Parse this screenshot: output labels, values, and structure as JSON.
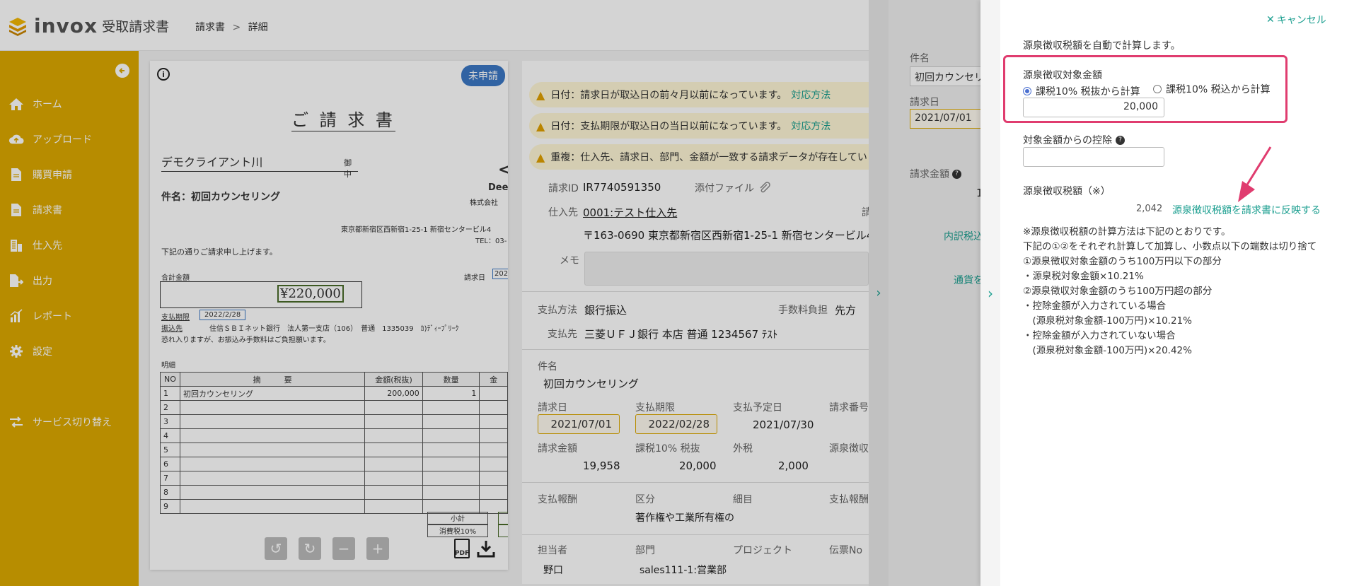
{
  "header": {
    "logo_text": "invox",
    "logo_sub": "受取請求書",
    "breadcrumb_1": "請求書",
    "breadcrumb_sep": ">",
    "breadcrumb_2": "詳細"
  },
  "sidebar": {
    "items": [
      {
        "label": "ホーム",
        "icon": "home-icon"
      },
      {
        "label": "アップロード",
        "icon": "cloud-upload-icon"
      },
      {
        "label": "購買申請",
        "icon": "file-icon"
      },
      {
        "label": "請求書",
        "icon": "file-icon"
      },
      {
        "label": "仕入先",
        "icon": "building-icon"
      },
      {
        "label": "出力",
        "icon": "export-icon"
      },
      {
        "label": "レポート",
        "icon": "chart-icon"
      },
      {
        "label": "設定",
        "icon": "gear-icon"
      }
    ],
    "service_switch": "サービス切り替え"
  },
  "document": {
    "status_badge": "未申請",
    "title": "ご 請 求 書",
    "client": "デモクライアント川",
    "client_suffix": "御中",
    "subject": "件名：初回カウンセリング",
    "company_short": "Deep",
    "company_suffix": "株式会社",
    "address": "東京都新宿区西新宿1-25-1 新宿センタービル4",
    "tel": "TEL：03-",
    "greeting": "下記の通りご請求申し上げます。",
    "total_label": "合計金額",
    "total_amount": "¥220,000",
    "invoice_date_label": "請求日",
    "invoice_date_val": "202",
    "due_label": "支払期限",
    "due_val": "2022/2/28",
    "bank_label": "振込先",
    "bank_val": "住信ＳＢＩネット銀行　法人第一支店（106）　普通　1335039　ｶ)ﾃﾞｨｰﾌﾟﾘｰｸ",
    "fee_note": "恐れ入りますが、お振込み手数料はご負担願います。",
    "meisai_label": "明細",
    "table_headers": [
      "NO",
      "摘　　　要",
      "金額(税抜)",
      "数量",
      "金"
    ],
    "table_rows": [
      [
        "1",
        "初回カウンセリング",
        "200,000",
        "1"
      ],
      [
        "2",
        "",
        "",
        ""
      ],
      [
        "3",
        "",
        "",
        ""
      ],
      [
        "4",
        "",
        "",
        ""
      ],
      [
        "5",
        "",
        "",
        ""
      ],
      [
        "6",
        "",
        "",
        ""
      ],
      [
        "7",
        "",
        "",
        ""
      ],
      [
        "8",
        "",
        "",
        ""
      ],
      [
        "9",
        "",
        "",
        ""
      ]
    ],
    "subtotal_label": "小計",
    "tax_label": "消費税10%",
    "pdf_label": "PDF"
  },
  "warnings": [
    {
      "text": "日付：請求日が取込日の前々月以前になっています。",
      "link": "対応方法"
    },
    {
      "text": "日付：支払期限が取込日の当日以前になっています。",
      "link": "対応方法"
    },
    {
      "text": "重複：仕入先、請求日、部門、金額が一致する請求データが存在してい",
      "link": ""
    }
  ],
  "info": {
    "invoice_id_label": "請求ID",
    "invoice_id": "IR7740591350",
    "attach_label": "添付ファイル",
    "supplier_label": "仕入先",
    "supplier": "0001:テスト仕入先",
    "supplier_extra": "請",
    "supplier_address": "〒163-0690 東京都新宿区西新宿1-25-1 新宿センタービル4",
    "memo_label": "メモ",
    "pay_method_label": "支払方法",
    "pay_method": "銀行振込",
    "fee_label": "手数料負担",
    "fee_val": "先方",
    "payee_label": "支払先",
    "payee": "三菱ＵＦＪ銀行 本店 普通 1234567 ﾃｽﾄ",
    "subject_label": "件名",
    "subject": "初回カウンセリング",
    "invoice_date_label": "請求日",
    "invoice_date": "2021/07/01",
    "due_label": "支払期限",
    "due": "2022/02/28",
    "scheduled_label": "支払予定日",
    "scheduled": "2021/07/30",
    "invoice_no_label": "請求番号",
    "amount_label": "請求金額",
    "amount": "19,958",
    "taxbase_label": "課税10% 税抜",
    "taxbase": "20,000",
    "outer_tax_label": "外税",
    "outer_tax": "2,000",
    "withholding_label": "源泉徴収",
    "remuneration_label": "支払報酬",
    "category_label": "区分",
    "category": "著作権や工業所有権の",
    "detail_label": "細目",
    "remuneration_label2": "支払報酬",
    "person_label": "担当者",
    "person": "野口",
    "dept_label": "部門",
    "dept": "sales111-1:営業部",
    "project_label": "プロジェクト",
    "slip_label": "伝票No"
  },
  "right_col": {
    "subject_label": "件名",
    "subject": "初回カウンセリ",
    "date_label": "請求日",
    "date": "2021/07/01",
    "amount_label": "請求金額",
    "amount_partial": "1",
    "tax_link": "内訳税込",
    "currency_link": "通貨を"
  },
  "panel": {
    "cancel": "キャンセル",
    "intro": "源泉徴収税額を自動で計算します。",
    "target_label": "源泉徴収対象金額",
    "radio_1": "課税10% 税抜から計算",
    "radio_2": "課税10% 税込から計算",
    "target_value": "20,000",
    "deduct_label": "対象金額からの控除",
    "deduct_value": "",
    "tax_label": "源泉徴収税額（※）",
    "tax_value": "2,042",
    "reflect_link": "源泉徴収税額を請求書に反映する",
    "notes": [
      "※源泉徴収税額の計算方法は下記のとおりです。",
      "下記の①②をそれぞれ計算して加算し、小数点以下の端数は切り捨て",
      "①源泉徴収対象金額のうち100万円以下の部分",
      "・源泉税対象金額×10.21%",
      "②源泉徴収対象金額のうち100万円超の部分",
      "・控除金額が入力されている場合",
      "　(源泉税対象金額-100万円)×10.21%",
      "・控除金額が入力されていない場合",
      "　(源泉税対象金額-100万円)×20.42%"
    ]
  },
  "colors": {
    "sidebar": "#dca900",
    "accent_teal": "#1a9e8f",
    "highlight": "#e03c6f",
    "badge": "#3b78c4"
  }
}
